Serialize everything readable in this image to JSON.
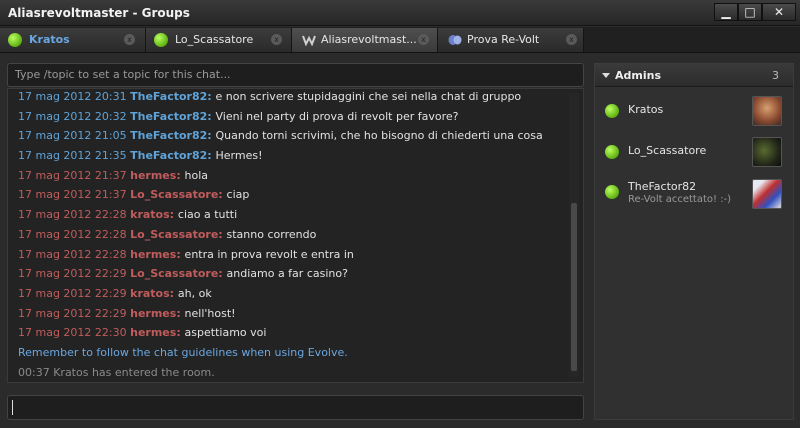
{
  "window": {
    "title": "Aliasrevoltmaster - Groups"
  },
  "window_controls": {
    "minimize": "▁",
    "maximize": "□",
    "close": "✕"
  },
  "tabs": [
    {
      "label": "Kratos",
      "icon": "status-dot-green-icon",
      "highlight": true
    },
    {
      "label": "Lo_Scassatore",
      "icon": "status-dot-green-icon",
      "highlight": false
    },
    {
      "label": "Aliasrevoltmast...",
      "icon": "evolve-logo-icon",
      "highlight": false,
      "active": true
    },
    {
      "label": "Prova Re-Volt",
      "icon": "game-group-icon",
      "highlight": false
    }
  ],
  "tab_close_glyph": "x",
  "topic": {
    "placeholder": "Type /topic to set a topic for this chat..."
  },
  "messages": [
    {
      "time": "17 mag 2012 20:31",
      "nick": "TheFactor82",
      "text": "e non scrivere stupidaggini che sei nella chat di gruppo",
      "color": "blue"
    },
    {
      "time": "17 mag 2012 20:32",
      "nick": "TheFactor82",
      "text": "Vieni nel party di prova di revolt per favore?",
      "color": "blue"
    },
    {
      "time": "17 mag 2012 21:05",
      "nick": "TheFactor82",
      "text": "Quando torni scrivimi, che ho bisogno di chiederti una cosa",
      "color": "blue"
    },
    {
      "time": "17 mag 2012 21:35",
      "nick": "TheFactor82",
      "text": "Hermes!",
      "color": "blue"
    },
    {
      "time": "17 mag 2012 21:37",
      "nick": "hermes",
      "text": "hola",
      "color": "red"
    },
    {
      "time": "17 mag 2012 21:37",
      "nick": "Lo_Scassatore",
      "text": "ciap",
      "color": "red"
    },
    {
      "time": "17 mag 2012 22:28",
      "nick": "kratos",
      "text": "ciao a tutti",
      "color": "red"
    },
    {
      "time": "17 mag 2012 22:28",
      "nick": "Lo_Scassatore",
      "text": "stanno correndo",
      "color": "red"
    },
    {
      "time": "17 mag 2012 22:28",
      "nick": "hermes",
      "text": "entra in prova revolt e entra in",
      "color": "red"
    },
    {
      "time": "17 mag 2012 22:29",
      "nick": "Lo_Scassatore",
      "text": "andiamo a far casino?",
      "color": "red"
    },
    {
      "time": "17 mag 2012 22:29",
      "nick": "kratos",
      "text": "ah, ok",
      "color": "red"
    },
    {
      "time": "17 mag 2012 22:29",
      "nick": "hermes",
      "text": "nell'host!",
      "color": "red"
    },
    {
      "time": "17 mag 2012 22:30",
      "nick": "hermes",
      "text": "aspettiamo voi",
      "color": "red"
    }
  ],
  "system_message": "Remember to follow the chat guidelines when using Evolve.",
  "entered_room": {
    "time": "00:37",
    "text": "Kratos has entered the room."
  },
  "admins_panel": {
    "title": "Admins",
    "count": "3",
    "members": [
      {
        "name": "Kratos",
        "status": "",
        "avatar": "kratos-avatar"
      },
      {
        "name": "Lo_Scassatore",
        "status": "",
        "avatar": "lo-scassatore-avatar"
      },
      {
        "name": "TheFactor82",
        "status": "Re-Volt accettato! :-)",
        "avatar": "thefactor82-avatar"
      }
    ]
  },
  "colors": {
    "blue_nick": "#5fa3d8",
    "red_nick": "#c05c5c",
    "system": "#6aa7e0",
    "online": "#6cc01a"
  }
}
